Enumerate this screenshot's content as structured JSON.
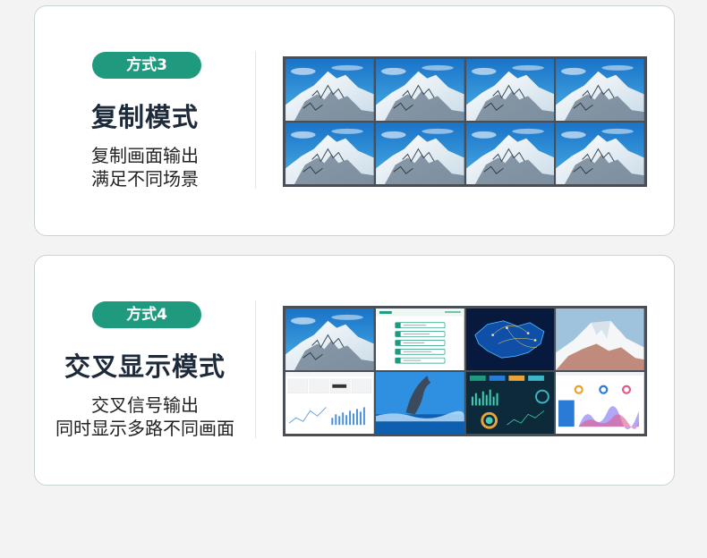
{
  "cards": [
    {
      "badge": "方式3",
      "title": "复制模式",
      "desc_line1": "复制画面输出",
      "desc_line2": "满足不同场景"
    },
    {
      "badge": "方式4",
      "title": "交叉显示模式",
      "desc_line1": "交叉信号输出",
      "desc_line2": "同时显示多路不同画面"
    }
  ],
  "colors": {
    "badge_bg": "#1f9a7e",
    "title": "#1d2a3a",
    "bezel": "#4a4f55",
    "sky": "#2b8fd6"
  }
}
